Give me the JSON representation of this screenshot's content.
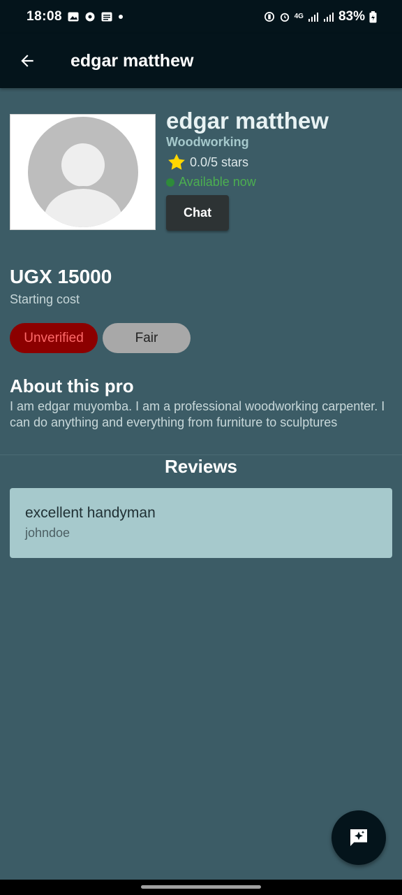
{
  "status_bar": {
    "time": "18:08",
    "battery": "83%",
    "network": "4G",
    "icons": [
      "image-icon",
      "app-icon",
      "message-icon",
      "dot-icon",
      "battery-saver-icon",
      "alarm-icon",
      "data-icon",
      "signal-icon",
      "signal-icon",
      "battery-icon"
    ]
  },
  "app_bar": {
    "title": "edgar matthew",
    "back_icon": "arrow-left-icon"
  },
  "profile": {
    "name": "edgar matthew",
    "category": "Woodworking",
    "rating_text": "0.0/5 stars",
    "availability": "Available now",
    "chat_label": "Chat",
    "avatar_icon": "default-avatar-icon"
  },
  "pricing": {
    "amount": "UGX 15000",
    "label": "Starting cost"
  },
  "badges": {
    "verification": "Unverified",
    "rating_level": "Fair"
  },
  "about": {
    "heading": "About this pro",
    "text": "I am edgar muyomba. I am a professional woodworking carpenter. I can do anything and everything from furniture to sculptures"
  },
  "reviews": {
    "heading": "Reviews",
    "items": [
      {
        "text": "excellent handyman",
        "user": "johndoe"
      }
    ]
  },
  "fab": {
    "icon": "ai-sparkle-chat-icon"
  },
  "colors": {
    "background": "#3c5c66",
    "app_bar": "#04141b",
    "accent_teal": "#a6c9cc",
    "available_green": "#4caf50",
    "unverified_bg": "#8c0000",
    "unverified_text": "#ff6a6a",
    "star": "#ffd700"
  }
}
